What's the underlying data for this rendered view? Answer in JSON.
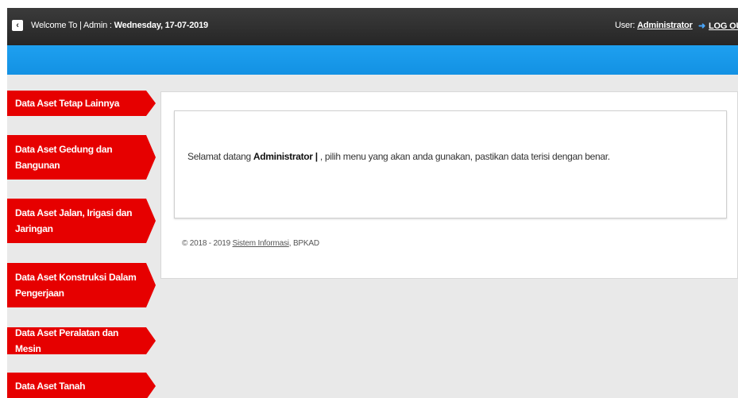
{
  "header": {
    "toggle_icon": "‹",
    "welcome_prefix": "Welcome To | Admin : ",
    "date": "Wednesday, 17-07-2019",
    "user_label": "User: ",
    "user_name": "Administrator",
    "logout_icon": "➜",
    "logout_label": "LOG OUT"
  },
  "sidebar": {
    "items": [
      {
        "label": "Data Aset Tetap Lainnya"
      },
      {
        "label": "Data Aset Gedung dan Bangunan"
      },
      {
        "label": "Data Aset Jalan, Irigasi dan Jaringan"
      },
      {
        "label": "Data Aset Konstruksi Dalam Pengerjaan"
      },
      {
        "label": "Data Aset Peralatan dan Mesin"
      },
      {
        "label": "Data Aset Tanah"
      }
    ]
  },
  "main": {
    "greeting_prefix": "Selamat datang ",
    "greeting_user": "Administrator |",
    "greeting_suffix": " , pilih menu yang akan anda gunakan, pastikan data terisi dengan benar.",
    "footer_prefix": "© 2018 - 2019 ",
    "footer_link": "Sistem Informasi",
    "footer_suffix": ", BPKAD"
  },
  "colors": {
    "topbar": "#2e2e2e",
    "accent_blue": "#1a9bee",
    "menu_red": "#e60000",
    "background": "#e9e9e9"
  }
}
